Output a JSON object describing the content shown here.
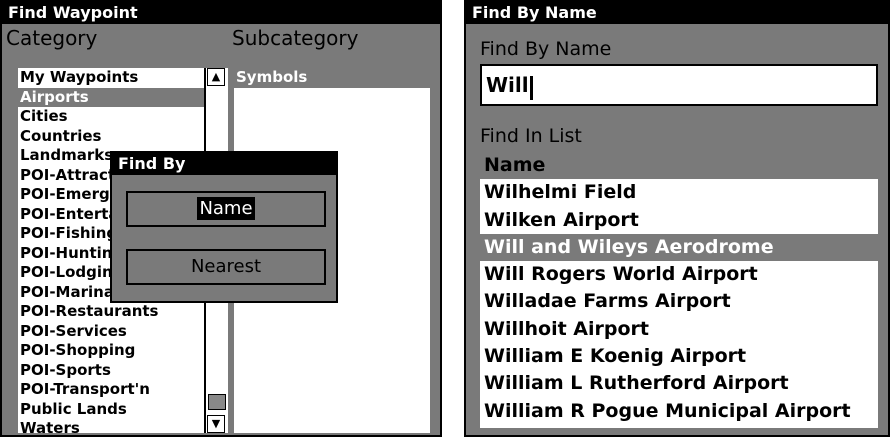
{
  "left": {
    "title": "Find Waypoint",
    "category_header": "Category",
    "subcategory_header": "Subcategory",
    "categories": [
      "My Waypoints",
      "Airports",
      "Cities",
      "Countries",
      "Landmarks",
      "POI-Attractions",
      "POI-Emergency",
      "POI-Entertainment",
      "POI-Fishing",
      "POI-Hunting",
      "POI-Lodging",
      "POI-Marinas",
      "POI-Restaurants",
      "POI-Services",
      "POI-Shopping",
      "POI-Sports",
      "POI-Transport'n",
      "Public Lands",
      "Waters"
    ],
    "selected_category": "Airports",
    "subcategories": [
      "Symbols"
    ],
    "selected_subcategory": "Symbols",
    "scroll": {
      "up_icon": "triangle-up",
      "down_icon": "triangle-down"
    },
    "dialog": {
      "title": "Find By",
      "buttons": [
        "Name",
        "Nearest"
      ],
      "focused": "Name"
    }
  },
  "right": {
    "title": "Find By Name",
    "field_label": "Find By Name",
    "input_value": "Will",
    "list_label": "Find In List",
    "column_header": "Name",
    "results": [
      "Wilhelmi Field",
      "Wilken Airport",
      "Will and Wileys Aerodrome",
      "Will Rogers World Airport",
      "Willadae Farms Airport",
      "Willhoit Airport",
      "William E Koenig Airport",
      "William L Rutherford Airport",
      "William R Pogue Municipal Airport"
    ],
    "selected_result": "Will and Wileys Aerodrome"
  }
}
